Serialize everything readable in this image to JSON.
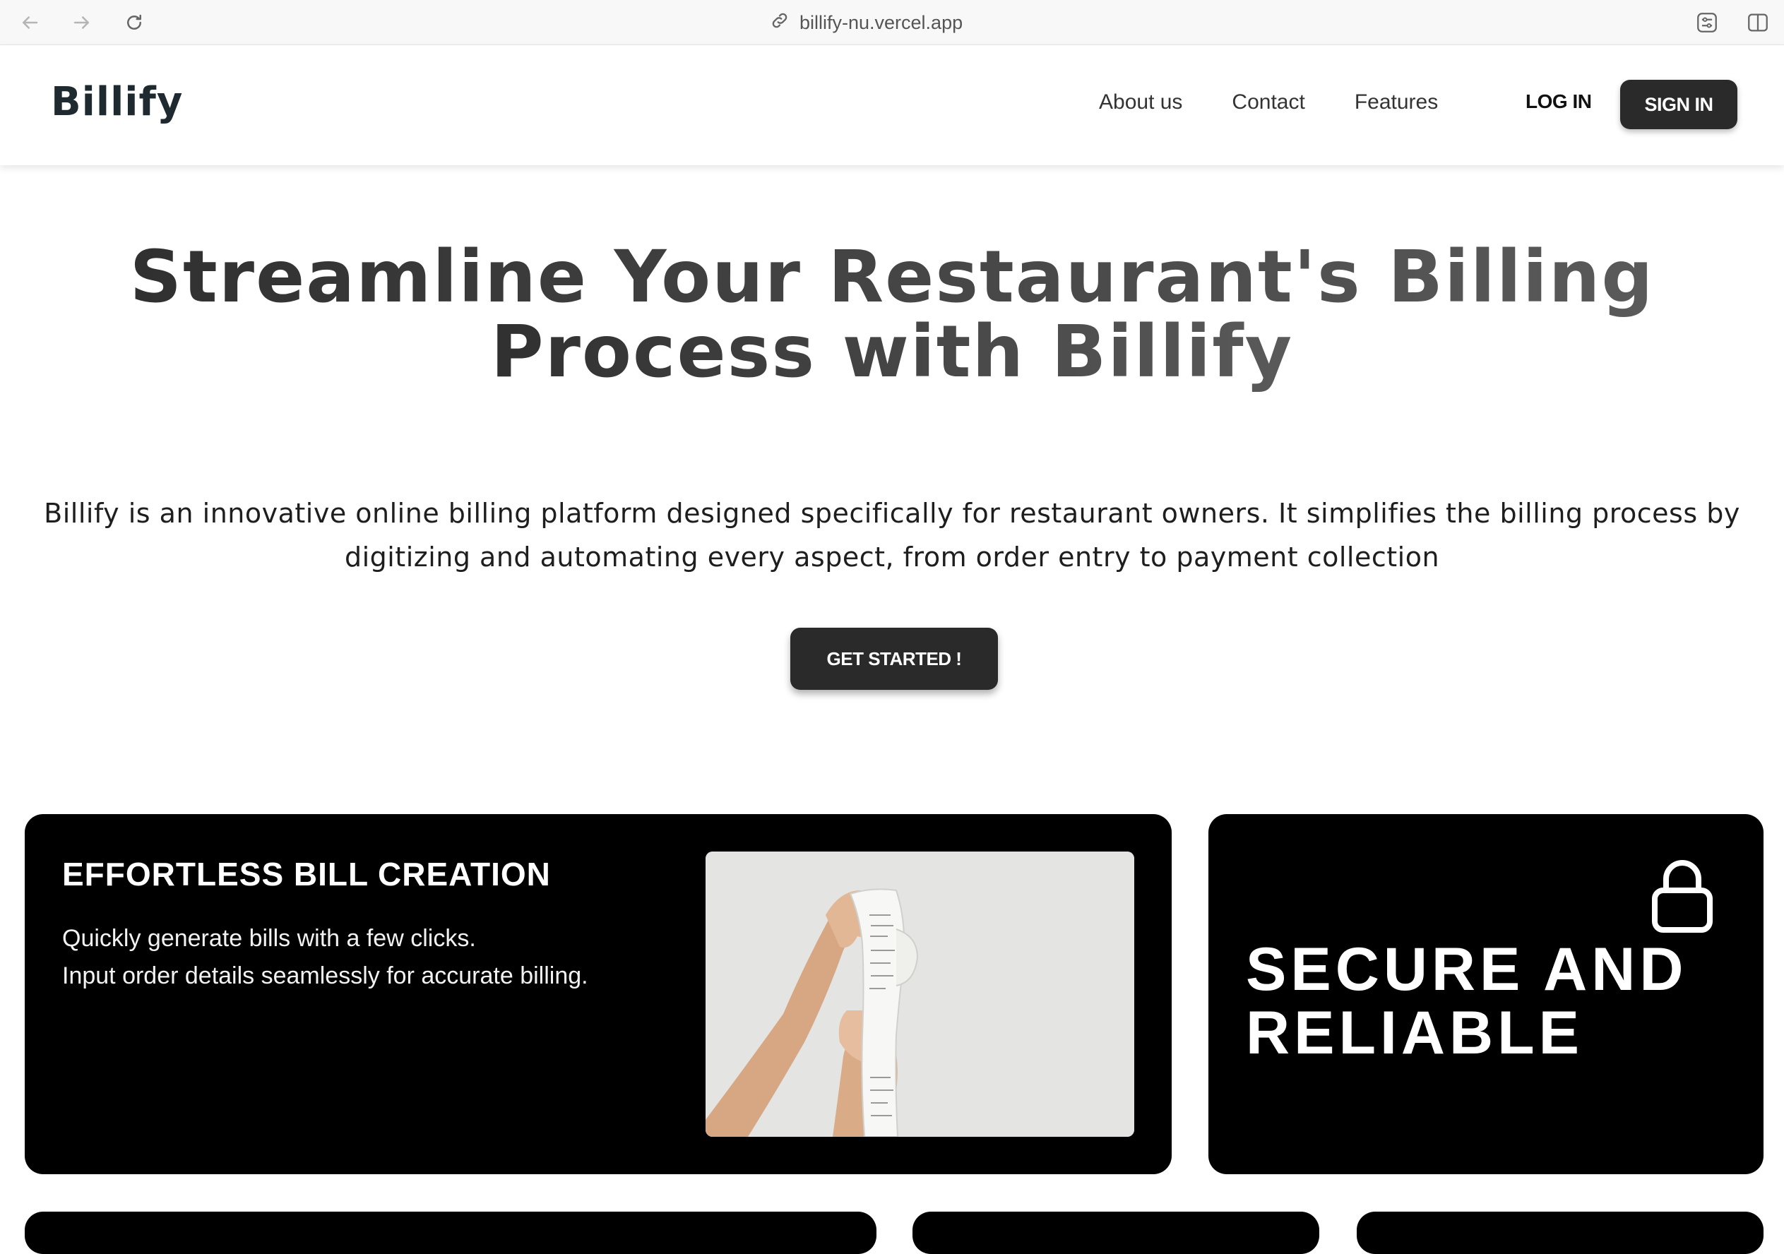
{
  "browser": {
    "url": "billify-nu.vercel.app",
    "icons": [
      "back-icon",
      "forward-icon",
      "reload-icon",
      "link-icon",
      "extensions-icon",
      "sidebar-icon"
    ]
  },
  "header": {
    "logo": "Billify",
    "nav": [
      "About us",
      "Contact",
      "Features"
    ],
    "login_label": "LOG IN",
    "signin_label": "SIGN IN"
  },
  "hero": {
    "title_line1": "Streamline Your Restaurant's Billing",
    "title_line2": "Process with Billify",
    "description": "Billify is an innovative online billing platform designed specifically for restaurant owners. It simplifies the billing process by digitizing and automating every aspect, from order entry to payment collection",
    "cta_label": "GET STARTED !"
  },
  "features": {
    "card1": {
      "title": "EFFORTLESS BILL CREATION",
      "line1": "Quickly generate bills with a few clicks.",
      "line2": "Input order details seamlessly for accurate billing.",
      "image": "hands-holding-receipt-photo"
    },
    "card2": {
      "title_line1": "SECURE AND",
      "title_line2": "RELIABLE",
      "icon": "lock-icon"
    }
  },
  "colors": {
    "button_bg": "#2a2a2a",
    "card_bg": "#000000",
    "heading": "#3a3a3a"
  }
}
